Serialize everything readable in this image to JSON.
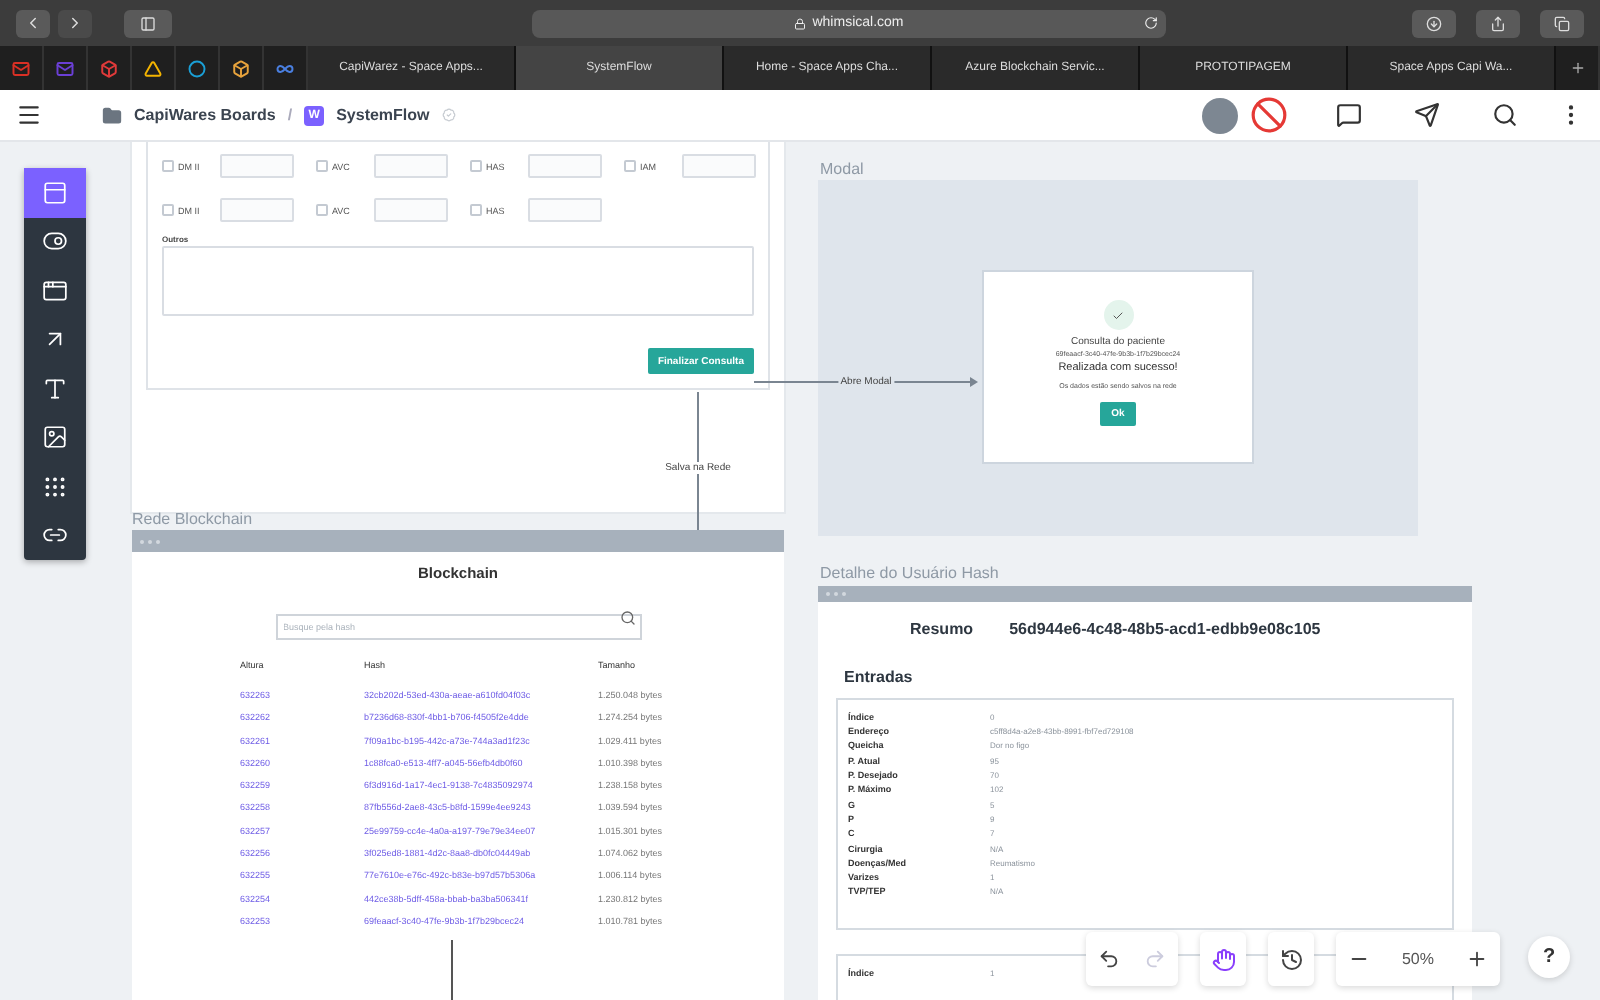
{
  "browser": {
    "url": "whimsical.com",
    "icon_tabs": [
      {
        "kind": "mail",
        "color": "#d93025"
      },
      {
        "kind": "mail",
        "color": "#6b3fd6"
      },
      {
        "kind": "app",
        "color": "#e03a3a"
      },
      {
        "kind": "triangle",
        "color": "#f4b400"
      },
      {
        "kind": "circle",
        "color": "#1a9fd6"
      },
      {
        "kind": "box",
        "color": "#e8a33c"
      },
      {
        "kind": "infinity",
        "color": "#4a7fe0"
      }
    ],
    "tabs": [
      {
        "label": "CapiWarez - Space Apps...",
        "selected": false
      },
      {
        "label": "SystemFlow",
        "selected": true
      },
      {
        "label": "Home - Space Apps Cha...",
        "selected": false
      },
      {
        "label": "Azure Blockchain Servic...",
        "selected": false
      },
      {
        "label": "PROTOTIPAGEM",
        "selected": false
      },
      {
        "label": "Space Apps Capi Wa...",
        "selected": false
      }
    ]
  },
  "header": {
    "board": "CapiWares Boards",
    "separator": "/",
    "logo": "W",
    "title": "SystemFlow"
  },
  "tools": [
    {
      "kind": "frame",
      "selected": true
    },
    {
      "kind": "widgets",
      "selected": false
    },
    {
      "kind": "device",
      "selected": false
    },
    {
      "kind": "arrow",
      "selected": false
    },
    {
      "kind": "text",
      "selected": false
    },
    {
      "kind": "image",
      "selected": false
    },
    {
      "kind": "grid",
      "selected": false
    },
    {
      "kind": "link",
      "selected": false
    }
  ],
  "form": {
    "checkbox_rows": [
      {
        "items": [
          {
            "label": "DM II",
            "checked": false
          },
          {
            "label": "AVC",
            "checked": false
          },
          {
            "label": "HAS",
            "checked": false
          },
          {
            "label": "IAM",
            "checked": false
          }
        ]
      },
      {
        "items": [
          {
            "label": "DM II",
            "checked": false
          },
          {
            "label": "AVC",
            "checked": false
          },
          {
            "label": "HAS",
            "checked": false
          }
        ]
      }
    ],
    "other_label": "Outros",
    "button": "Finalizar Consulta"
  },
  "connectors": {
    "open_modal": "Abre Modal",
    "save": "Salva na Rede"
  },
  "modal_frame": {
    "label": "Modal",
    "title": "Consulta do paciente",
    "hash": "69feaacf-3c40-47fe-9b3b-1f7b29bcec24",
    "message": "Realizada com sucesso!",
    "note": "Os dados estão sendo salvos na rede",
    "button": "Ok"
  },
  "blockchain": {
    "label": "Rede Blockchain",
    "title": "Blockchain",
    "search_placeholder": "Busque pela hash",
    "columns": [
      "Altura",
      "Hash",
      "Tamanho"
    ],
    "rows": [
      [
        "632263",
        "32cb202d-53ed-430a-aeae-a610fd04f03c",
        "1.250.048 bytes"
      ],
      [
        "632262",
        "b7236d68-830f-4bb1-b706-f4505f2e4dde",
        "1.274.254 bytes"
      ],
      [
        "632261",
        "7f09a1bc-b195-442c-a73e-744a3ad1f23c",
        "1.029.411 bytes"
      ],
      [
        "632260",
        "1c88fca0-e513-4ff7-a045-56efb4db0f60",
        "1.010.398 bytes"
      ],
      [
        "632259",
        "6f3d916d-1a17-4ec1-9138-7c4835092974",
        "1.238.158 bytes"
      ],
      [
        "632258",
        "87fb556d-2ae8-43c5-b8fd-1599e4ee9243",
        "1.039.594 bytes"
      ],
      [
        "632257",
        "25e99759-cc4e-4a0a-a197-79e79e34ee07",
        "1.015.301 bytes"
      ],
      [
        "632256",
        "3f025ed8-1881-4d2c-8aa8-db0fc04449ab",
        "1.074.062 bytes"
      ],
      [
        "632255",
        "77e7610e-e76c-492c-b83e-b97d57b5306a",
        "1.006.114 bytes"
      ],
      [
        "632254",
        "442ce38b-5dff-458a-bbab-ba3ba506341f",
        "1.230.812 bytes"
      ],
      [
        "632253",
        "69feaacf-3c40-47fe-9b3b-1f7b29bcec24",
        "1.010.781 bytes"
      ]
    ]
  },
  "detail": {
    "label": "Detalhe do Usuário Hash",
    "summary_label": "Resumo",
    "summary_hash": "56d944e6-4c48-48b5-acd1-edbb9e08c105",
    "section": "Entradas",
    "entries": [
      {
        "fields": [
          {
            "key": "Índice",
            "value": "0"
          },
          {
            "key": "Endereço",
            "value": "c5ff8d4a-a2e8-43bb-8991-fbf7ed729108"
          },
          {
            "key": "Queicha",
            "value": "Dor no figo"
          },
          {
            "key": "P. Atual",
            "value": "95"
          },
          {
            "key": "P. Desejado",
            "value": "70"
          },
          {
            "key": "P. Máximo",
            "value": "102"
          },
          {
            "key": "G",
            "value": "5"
          },
          {
            "key": "P",
            "value": "9"
          },
          {
            "key": "C",
            "value": "7"
          },
          {
            "key": "Cirurgia",
            "value": "N/A"
          },
          {
            "key": "Doenças/Med",
            "value": "Reumatismo"
          },
          {
            "key": "Varizes",
            "value": "1"
          },
          {
            "key": "TVP/TEP",
            "value": "N/A"
          }
        ]
      },
      {
        "fields": [
          {
            "key": "Índice",
            "value": "1"
          }
        ]
      }
    ]
  },
  "canvas_tools": [
    {
      "kind": "undo",
      "selected": false,
      "disabled": false
    },
    {
      "kind": "redo",
      "selected": false,
      "disabled": true
    },
    {
      "kind": "hand",
      "selected": true,
      "disabled": false
    },
    {
      "kind": "history",
      "selected": false,
      "disabled": false
    }
  ],
  "zoom": "50%",
  "help": "?"
}
